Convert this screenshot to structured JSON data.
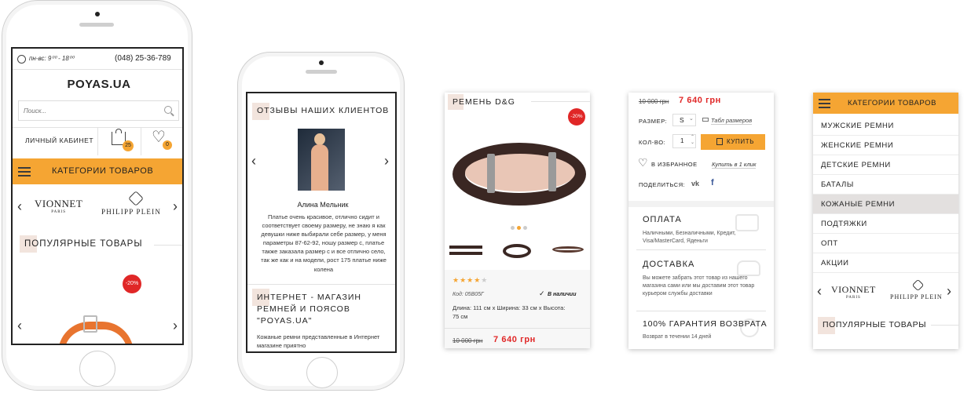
{
  "phone1": {
    "hours": "пн-вс: 9⁰⁰ - 18⁰⁰",
    "phone": "(048) 25-36-789",
    "logo": "POYAS.UA",
    "search_placeholder": "Поиск...",
    "account": "ЛИЧНЫЙ КАБИНЕТ",
    "cart_count": "25",
    "wish_count": "0",
    "categories": "КАТЕГОРИИ ТОВАРОВ",
    "brand1": "VIONNET",
    "brand1_sub": "PARIS",
    "brand2": "PHILIPP PLEIN",
    "popular": "ПОПУЛЯРНЫЕ ТОВАРЫ",
    "discount": "-20%"
  },
  "phone2": {
    "reviews_title": "ОТЗЫВЫ НАШИХ КЛИЕНТОВ",
    "reviewer": "Алина Мельник",
    "review_text": "Платье очень красивое, отлично сидит и соответствует своему размеру, не знаю я как девушки ниже выбирали себе размер, у меня параметры 87-62-92, ношу размер с, платье также заказала размер с и все отлично село, так же как и на модели, рост 175 платье ниже колена",
    "shop_title": "ИНТЕРНЕТ - МАГАЗИН РЕМНЕЙ И ПОЯСОВ \"POYAS.UA\"",
    "shop_text": "Кожаные ремни представленные в Интернет магазине приятно"
  },
  "card1": {
    "title": "РЕМЕНЬ D&G",
    "discount": "-20%",
    "rating": "4 из 5",
    "code": "Код: 05В05Г",
    "in_stock": "В наличии",
    "dims": "Длина: 111 см х Ширина: 33 см х Высота: 75 см",
    "old_price": "10 000 грн",
    "new_price": "7 640 грн"
  },
  "card2": {
    "old_price": "10 000 грн",
    "new_price": "7 640 грн",
    "size_label": "РАЗМЕР:",
    "size_value": "S",
    "size_table": "Табл размеров",
    "qty_label": "КОЛ-ВО:",
    "qty_value": "1",
    "buy": "КУПИТЬ",
    "favorites": "В ИЗБРАННОЕ",
    "one_click": "Купить в 1 клик",
    "share": "ПОДЕЛИТЬСЯ:",
    "payment_title": "ОПЛАТА",
    "payment_text": "Наличными, Безналичными, Кредит, Visa/MasterCard, Яденьги",
    "delivery_title": "ДОСТАВКА",
    "delivery_text": "Вы можете забрать этот товар из нашего магазина сами или мы доставим этот товар курьером службы доставки",
    "guarantee_title": "100% ГАРАНТИЯ ВОЗВРАТА",
    "guarantee_text": "Возврат в течении 14 дней"
  },
  "card3": {
    "categories": "КАТЕГОРИИ ТОВАРОВ",
    "items": [
      "МУЖСКИЕ РЕМНИ",
      "ЖЕНСКИЕ РЕМНИ",
      "ДЕТСКИЕ РЕМНИ",
      "БАТАЛЫ",
      "КОЖАНЫЕ РЕМНИ",
      "ПОДТЯЖКИ",
      "ОПТ",
      "АКЦИИ"
    ],
    "brand1": "VIONNET",
    "brand1_sub": "PARIS",
    "brand2": "PHILIPP PLEIN",
    "popular": "ПОПУЛЯРНЫЕ ТОВАРЫ"
  },
  "colors": {
    "accent": "#f5a533",
    "sale": "#e02727",
    "active_row": "#e3e0df"
  }
}
